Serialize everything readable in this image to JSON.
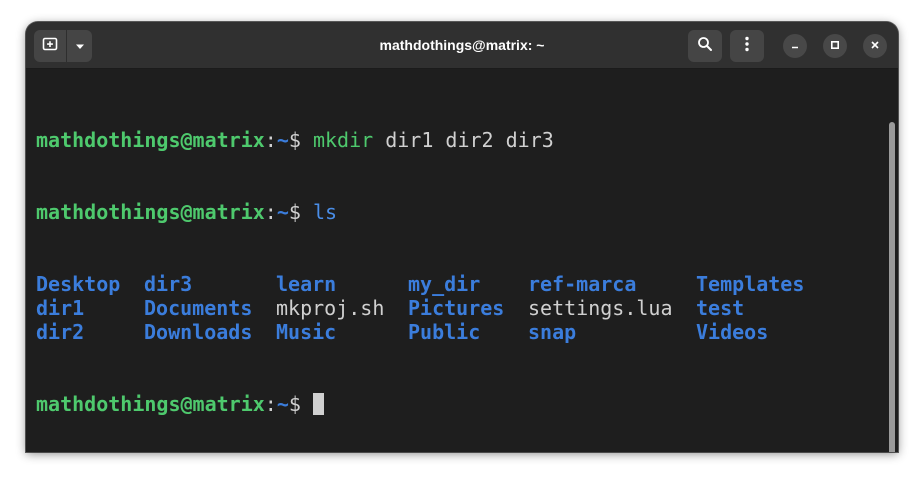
{
  "window": {
    "title": "mathdothings@matrix: ~"
  },
  "header_icons": {
    "new_tab": "new-tab-icon",
    "menu_dropdown": "chevron-down-icon",
    "search": "search-icon",
    "more": "kebab-menu-icon",
    "minimize": "minimize-icon",
    "maximize": "maximize-icon",
    "close": "close-icon"
  },
  "prompt": {
    "user_host": "mathdothings@matrix",
    "separator": ":",
    "path": "~",
    "symbol": "$ "
  },
  "commands": [
    {
      "name": "mkdir",
      "args": " dir1 dir2 dir3"
    },
    {
      "name": "ls",
      "args": ""
    }
  ],
  "ls_output": {
    "columns": [
      [
        "Desktop",
        "dir1",
        "dir2"
      ],
      [
        "dir3",
        "Documents",
        "Downloads"
      ],
      [
        "learn",
        "mkproj.sh",
        "Music"
      ],
      [
        "my_dir",
        "Pictures",
        "Public"
      ],
      [
        "ref-marca",
        "settings.lua",
        "snap"
      ],
      [
        "Templates",
        "test",
        "Videos"
      ]
    ],
    "regular_files": [
      "mkproj.sh",
      "settings.lua"
    ]
  },
  "colors": {
    "prompt_user": "#4ec96d",
    "prompt_path": "#3b7ddc",
    "directory": "#3b7ddc",
    "regular_file": "#d0d0d0",
    "terminal_bg": "#1e1e1e",
    "titlebar_bg": "#303030"
  }
}
